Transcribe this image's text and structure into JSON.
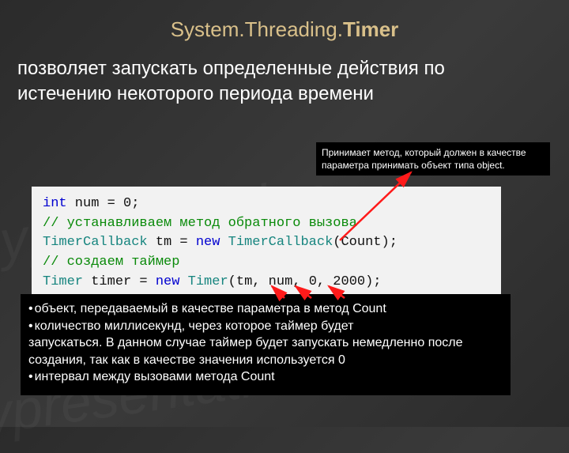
{
  "title": {
    "prefix": "System.Threading.",
    "bold": "Timer"
  },
  "description": "позволяет запускать определенные действия по истечению некоторого периода времени",
  "callout": "Принимает метод, который должен в качестве параметра принимать объект типа object.",
  "code": {
    "l1_kw": "int",
    "l1_rest": " num = 0;",
    "l2_com": "// устанавливаем метод обратного вызова",
    "l3_type1": "TimerCallback",
    "l3_a": " tm = ",
    "l3_kw": "new",
    "l3_b": " ",
    "l3_type2": "TimerCallback",
    "l3_c": "(Count);",
    "l4_com": "// создаем таймер",
    "l5_type1": "Timer",
    "l5_a": " timer = ",
    "l5_kw": "new",
    "l5_b": " ",
    "l5_type2": "Timer",
    "l5_c": "(tm, num, 0, 2000);"
  },
  "notes": {
    "i1": "объект, передаваемый в качестве параметра в метод Count",
    "i2a": "количество миллисекунд, через которое таймер будет",
    "i2b": "запускаться. В данном случае таймер будет запускать немедленно после создания, так как в качестве значения используется 0",
    "i3": "интервал между вызовами метода Count"
  },
  "colors": {
    "accent": "#d9c08a",
    "arrow": "#ff1a1a"
  }
}
